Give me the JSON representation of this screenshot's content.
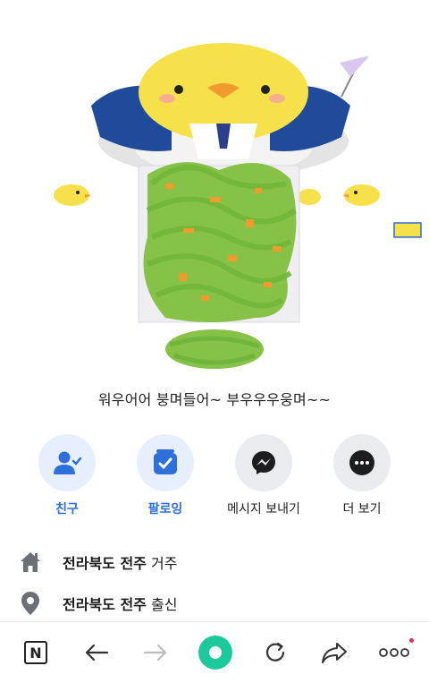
{
  "profile": {
    "status_message": "워우어어 붕며들어~ 부우우우웅며~~"
  },
  "actions": [
    {
      "label": "친구",
      "icon": "friend-check-icon"
    },
    {
      "label": "팔로잉",
      "icon": "following-check-icon"
    },
    {
      "label": "메시지 보내기",
      "icon": "messenger-icon"
    },
    {
      "label": "더 보기",
      "icon": "more-icon"
    }
  ],
  "info": {
    "residence": {
      "place": "전라북도 전주",
      "suffix": "거주",
      "icon": "home-icon"
    },
    "hometown": {
      "place": "전라북도 전주",
      "suffix": "출신",
      "icon": "location-pin-icon"
    }
  },
  "bottom_bar": {
    "logo_letter": "N",
    "items": [
      "n-logo-icon",
      "back-arrow-icon",
      "forward-arrow-icon",
      "green-home-icon",
      "refresh-icon",
      "share-icon",
      "more-dots-icon"
    ]
  },
  "colors": {
    "accent_blue": "#2f6fda",
    "green": "#1cc99b",
    "notification_red": "#e0324b"
  }
}
